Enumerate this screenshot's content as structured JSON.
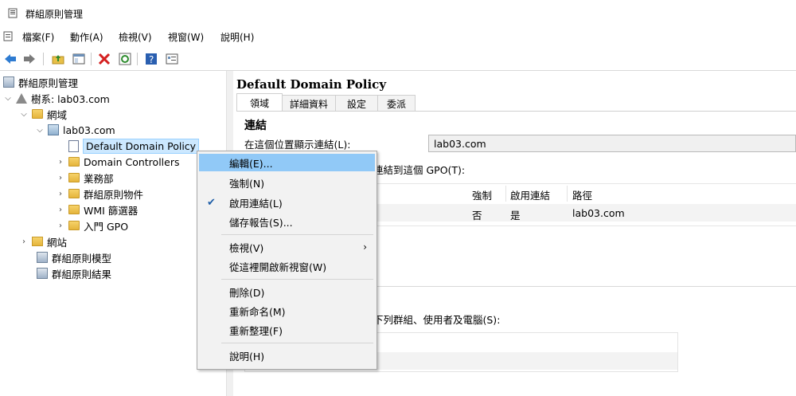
{
  "window": {
    "title": "群組原則管理"
  },
  "menubar": {
    "items": [
      "檔案(F)",
      "動作(A)",
      "檢視(V)",
      "視窗(W)",
      "說明(H)"
    ]
  },
  "toolbar": {
    "icons": [
      "back-arrow-icon",
      "forward-arrow-icon",
      "up-folder-icon",
      "show-hide-tree-icon",
      "delete-icon",
      "refresh-icon",
      "help-icon",
      "properties-icon"
    ]
  },
  "tree": {
    "root": "群組原則管理",
    "forest": "樹系: lab03.com",
    "domains": "網域",
    "domain": "lab03.com",
    "children": [
      "Default Domain Policy",
      "Domain Controllers",
      "業務部",
      "群組原則物件",
      "WMI 篩選器",
      "入門 GPO"
    ],
    "sites": "網站",
    "modeling": "群組原則模型",
    "results": "群組原則結果"
  },
  "detail": {
    "title": "Default Domain Policy",
    "tabs": [
      "領域",
      "詳細資料",
      "設定",
      "委派"
    ],
    "links_heading": "連結",
    "location_label": "在這個位置顯示連結(L):",
    "location_value": "lab03.com",
    "links_label_partial": "連結到這個 GPO(T):",
    "columns": [
      "強制",
      "啟用連結",
      "路徑"
    ],
    "rows": [
      {
        "enforced": "否",
        "enabled": "是",
        "path": "lab03.com"
      }
    ],
    "filter_label_partial": "下列群組、使用者及電腦(S):"
  },
  "context_menu": {
    "items": [
      {
        "label": "編輯(E)...",
        "highlighted": true
      },
      {
        "label": "強制(N)"
      },
      {
        "label": "啟用連結(L)",
        "checked": true
      },
      {
        "label": "儲存報告(S)..."
      },
      {
        "label": "檢視(V)",
        "submenu": true
      },
      {
        "label": "從這裡開啟新視窗(W)"
      },
      {
        "label": "刪除(D)"
      },
      {
        "label": "重新命名(M)"
      },
      {
        "label": "重新整理(F)"
      },
      {
        "label": "說明(H)"
      }
    ]
  },
  "colors": {
    "highlight": "#91c9f7",
    "selected": "#cce8ff",
    "back": "#2e7bd1"
  }
}
